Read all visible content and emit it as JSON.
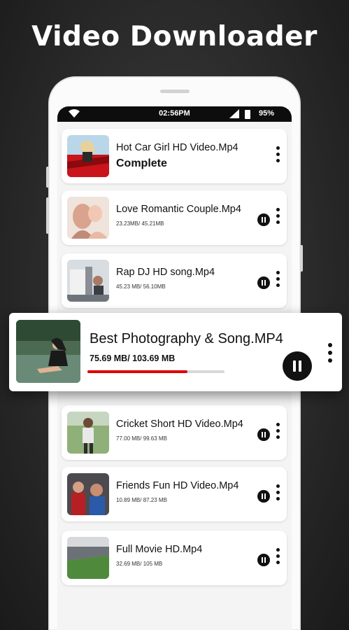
{
  "headline": "Video Downloader",
  "statusbar": {
    "time": "02:56PM",
    "battery": "95%"
  },
  "downloads": [
    {
      "title": "Hot Car Girl HD Video.Mp4",
      "status": "Complete",
      "size": ""
    },
    {
      "title": "Love Romantic Couple.Mp4",
      "status": "",
      "size": "23.23MB/  45.21MB"
    },
    {
      "title": "Rap DJ HD song.Mp4",
      "status": "",
      "size": "45.23 MB/ 56.10MB"
    },
    {
      "title": "Cricket Short HD Video.Mp4",
      "status": "",
      "size": "77.00 MB/ 99.63 MB"
    },
    {
      "title": "Friends Fun HD Video.Mp4",
      "status": "",
      "size": "10.89 MB/ 87.23 MB"
    },
    {
      "title": "Full Movie HD.Mp4",
      "status": "",
      "size": "32.69 MB/ 105 MB"
    }
  ],
  "featured": {
    "title": "Best Photography & Song.MP4",
    "size": "75.69 MB/ 103.69 MB",
    "progress": 0.73
  },
  "colors": {
    "progress": "#e00000",
    "accent": "#111111"
  },
  "icons": [
    "wifi-icon",
    "signal-icon",
    "battery-icon",
    "pause-icon",
    "more-vert-icon"
  ]
}
